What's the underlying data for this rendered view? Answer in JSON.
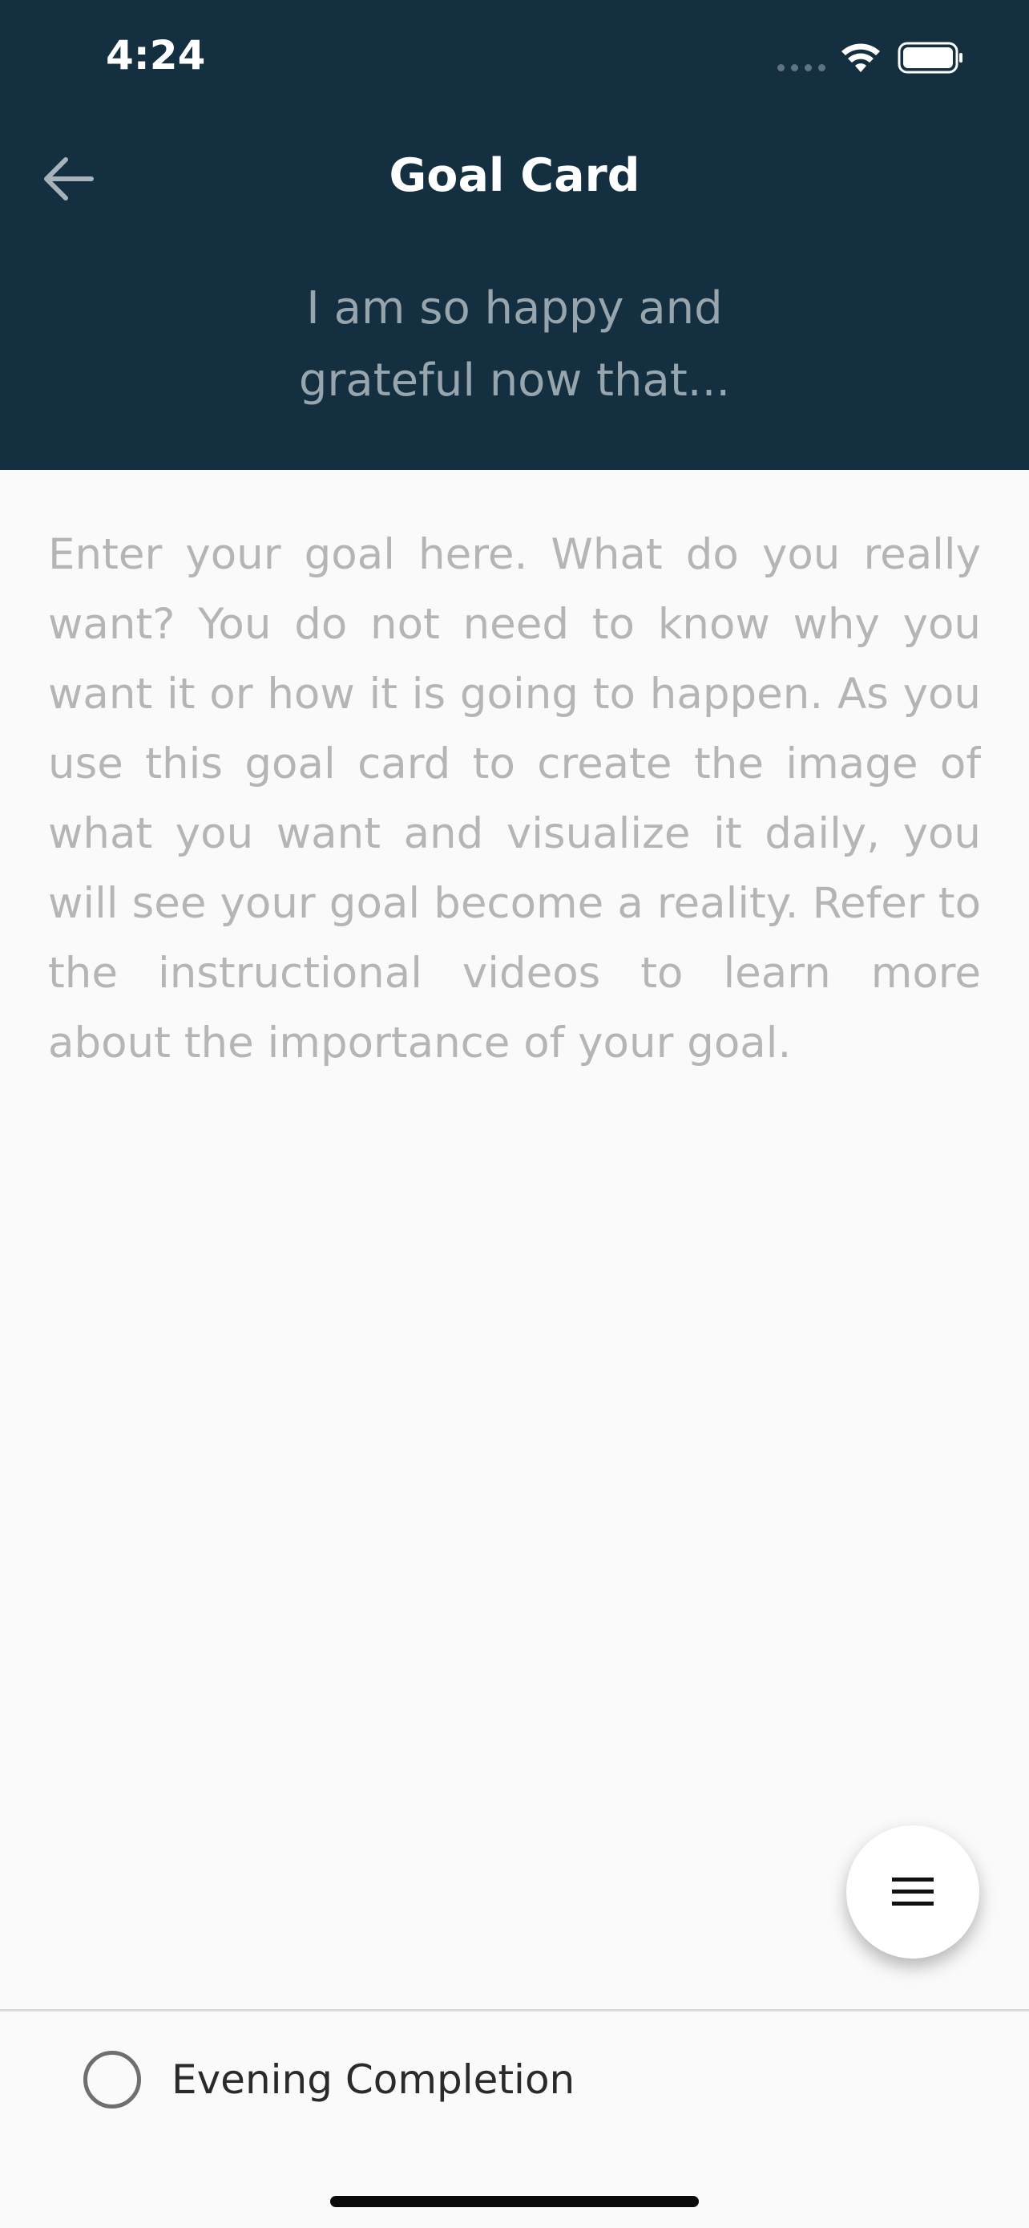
{
  "status_bar": {
    "time": "4:24"
  },
  "header": {
    "title": "Goal Card",
    "subtitle": "I am so happy and grateful now that..."
  },
  "goal": {
    "placeholder": "Enter your goal here. What do you really want? You do not need to know why you want it or how it is going to happen. As you use this goal card to create the image of what you want and visualize it daily, you will see your goal become a reality. Refer to the instructional videos to learn more about the importance of your goal."
  },
  "footer": {
    "evening_completion_label": "Evening Completion",
    "evening_completion_checked": false
  },
  "icons": {
    "back": "arrow-left-icon",
    "menu": "hamburger-menu-icon",
    "wifi": "wifi-icon",
    "battery": "battery-icon",
    "signal": "signal-dots-icon"
  },
  "colors": {
    "header_bg": "#142f40",
    "page_bg": "#fafafa",
    "subtitle": "#97a5ad",
    "placeholder": "#b5b5b5"
  }
}
